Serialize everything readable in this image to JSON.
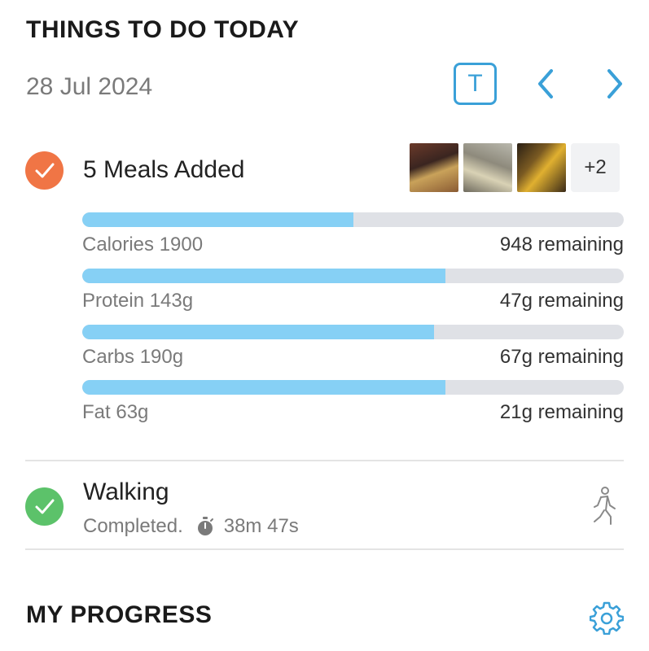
{
  "header": {
    "title": "THINGS TO DO TODAY",
    "date": "28 Jul 2024",
    "today_button": "T"
  },
  "meals": {
    "title": "5 Meals Added",
    "extra_count": "+2",
    "macros": [
      {
        "label": "Calories 1900",
        "remaining": "948 remaining",
        "progress": 0.5
      },
      {
        "label": "Protein 143g",
        "remaining": "47g remaining",
        "progress": 0.67
      },
      {
        "label": "Carbs 190g",
        "remaining": "67g remaining",
        "progress": 0.65
      },
      {
        "label": "Fat 63g",
        "remaining": "21g remaining",
        "progress": 0.67
      }
    ]
  },
  "walking": {
    "title": "Walking",
    "status": "Completed.",
    "duration": "38m 47s"
  },
  "progress_section": {
    "title": "MY PROGRESS"
  },
  "colors": {
    "accent": "#3aa0d8",
    "meals_check": "#f07545",
    "walking_check": "#5cc26a",
    "bar_fill": "#86d0f5",
    "bar_track": "#dfe1e6"
  },
  "icons": {
    "check": "check-icon",
    "prev": "chevron-left-icon",
    "next": "chevron-right-icon",
    "timer": "stopwatch-icon",
    "walk": "walking-person-icon",
    "settings": "gear-icon"
  }
}
